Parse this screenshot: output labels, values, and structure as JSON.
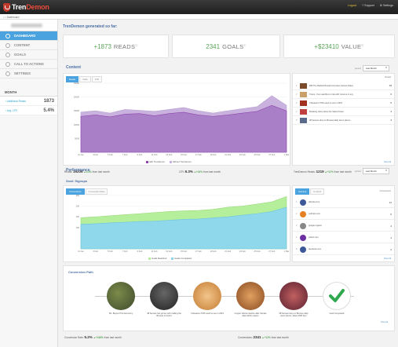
{
  "app": {
    "brand_prefix": "Tren",
    "brand_suffix": "Demon"
  },
  "topnav": {
    "logout": "Logout",
    "support": "Support",
    "settings": "Settings"
  },
  "breadcrumb": "Dashboard",
  "sidebar": {
    "items": [
      {
        "label": "Dashboard",
        "icon": "home-icon",
        "active": true
      },
      {
        "label": "Content",
        "icon": "content-icon",
        "active": false
      },
      {
        "label": "Goals",
        "icon": "goals-icon",
        "active": false
      },
      {
        "label": "Call to actions",
        "icon": "cta-icon",
        "active": false
      },
      {
        "label": "Settings",
        "icon": "gear-icon",
        "active": false
      }
    ],
    "month_title": "MONTH",
    "month_rows": [
      {
        "label": "Additional Reads",
        "value": "1873"
      },
      {
        "label": "Avg. LTR",
        "value": "5.4%"
      }
    ]
  },
  "generated": {
    "title": "TrenDemon generated so far:",
    "kpis": [
      {
        "value": "+1873",
        "label": "READS"
      },
      {
        "value": "2341",
        "label": "GOALS"
      },
      {
        "value": "+$23410",
        "label": "VALUE"
      }
    ]
  },
  "content": {
    "title": "Content",
    "period_label": "period",
    "period_value": "Last Month",
    "tabs": [
      "Reads",
      "Visits",
      "LTR"
    ],
    "legend": [
      "with Trendemon",
      "without Trendemon"
    ],
    "legend_colors": [
      "#8e44ad",
      "#c9b3de"
    ],
    "list_header": "Reads",
    "list": [
      {
        "title": "Will The Radical Reward Increase Interest Rates",
        "value": "18"
      },
      {
        "title": "Trains - from sacrifice to ride with Grooms or any",
        "value": "6"
      },
      {
        "title": "3 Reasons TMS need to use in 2015",
        "value": "5"
      },
      {
        "title": "Breaking down about the Sales Power",
        "value": "4"
      },
      {
        "title": "38 Senses drop on Browse daily items (items...",
        "value": "3"
      }
    ],
    "view_all": "View All",
    "stats": [
      {
        "label": "Reads",
        "value": "19206",
        "change": "5.3%",
        "note": "from last month"
      },
      {
        "label": "LTR",
        "value": "6.3%",
        "change": "+24%",
        "note": "from last month"
      },
      {
        "label": "TrenDemon Reads",
        "value": "1219",
        "change": "+12%",
        "note": "from last month"
      }
    ]
  },
  "performance": {
    "title": "Performance",
    "subtitle": "Goal: Signups",
    "period_label": "period",
    "period_value": "Last Month",
    "tabs": [
      "Conversions",
      "Conversion Rate"
    ],
    "legend": [
      "Goals Reached",
      "Goals Completed"
    ],
    "legend_colors": [
      "#b6ef9c",
      "#8fd7ea"
    ],
    "source_tabs": [
      "Sources",
      "Content"
    ],
    "source_header": "Conversions",
    "sources": [
      {
        "name": "taboola.com",
        "value": "12",
        "color": "#3b5998"
      },
      {
        "name": "outbrain.com",
        "value": "6",
        "color": "#e67e22"
      },
      {
        "name": "google organic",
        "value": "4",
        "color": "#888888"
      },
      {
        "name": "yahoo.com",
        "value": "4",
        "color": "#6b2fa1"
      },
      {
        "name": "facebook.com",
        "value": "2",
        "color": "#3b5998"
      }
    ],
    "view_all": "View All"
  },
  "conversion_path": {
    "title": "Conversion Path",
    "nodes": [
      "5G: Beyond The Economy",
      "38 Senses has grown with mailing the Browse to brand",
      "3 Reasons TMS need to use in 2015",
      "Copper futures decline after Senate data within reason",
      "38 Senses drop on Browse daily items (items, dates 3MP item",
      "Goal Completed"
    ],
    "view_all": "View All",
    "stats": [
      {
        "label": "Conversion Rate",
        "value": "5.2%",
        "change": "+248%",
        "note": "from last month"
      },
      {
        "label": "Conversions",
        "value": "2341",
        "change": "+12%",
        "note": "from last month"
      }
    ]
  },
  "chart_data": [
    {
      "type": "area",
      "title": "Content",
      "x": [
        "11 Jan",
        "3 Feb",
        "5 Feb",
        "7 Feb",
        "9 Feb",
        "11 Feb",
        "13 Feb",
        "15 Feb",
        "17 Feb",
        "19 Feb",
        "21 Feb",
        "23 Feb",
        "25 Feb",
        "27 Feb",
        "1 Mar"
      ],
      "ylim": [
        0,
        25000
      ],
      "yticks": [
        5000,
        10000,
        15000,
        20000,
        25000
      ],
      "series": [
        {
          "name": "with Trendemon",
          "values": [
            14500,
            15000,
            14200,
            15500,
            15200,
            14800,
            15500,
            16200,
            15000,
            14200,
            15000,
            15800,
            16500,
            20500,
            17000
          ]
        },
        {
          "name": "without Trendemon",
          "values": [
            13000,
            13500,
            12800,
            13800,
            14000,
            13200,
            14000,
            14500,
            13500,
            13000,
            13500,
            14200,
            14800,
            17000,
            15000
          ]
        }
      ],
      "grid": true,
      "legend": "bottom"
    },
    {
      "type": "area",
      "title": "Goal: Signups",
      "x": [
        "11 Jan",
        "3 Feb",
        "5 Feb",
        "7 Feb",
        "9 Feb",
        "11 Feb",
        "13 Feb",
        "15 Feb",
        "17 Feb",
        "19 Feb",
        "21 Feb",
        "23 Feb",
        "25 Feb",
        "27 Feb",
        "1 Mar"
      ],
      "ylim": [
        0,
        250
      ],
      "yticks": [
        100,
        150,
        200,
        250
      ],
      "series": [
        {
          "name": "Goals Reached",
          "values": [
            145,
            150,
            155,
            160,
            165,
            170,
            175,
            178,
            180,
            185,
            195,
            200,
            210,
            220,
            245
          ]
        },
        {
          "name": "Goals Completed",
          "values": [
            115,
            118,
            122,
            125,
            128,
            130,
            134,
            138,
            140,
            145,
            150,
            158,
            165,
            175,
            195
          ]
        }
      ],
      "grid": true,
      "legend": "bottom"
    }
  ]
}
